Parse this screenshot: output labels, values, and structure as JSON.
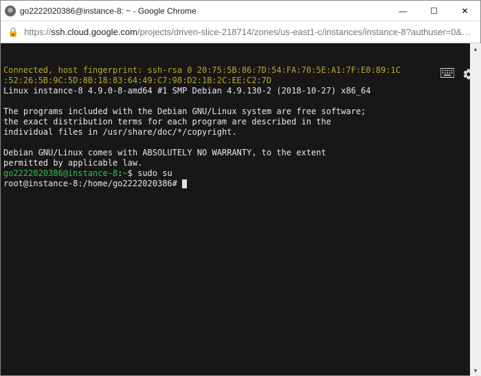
{
  "window": {
    "title": "go2222020386@instance-8: ~ - Google Chrome"
  },
  "address": {
    "scheme": "https://",
    "host": "ssh.cloud.google.com",
    "path": "/projects/driven-slice-218714/zones/us-east1-c/instances/instance-8?authuser=0&hl=zh_CN&..."
  },
  "terminal": {
    "conn_line1": "Connected, host fingerprint: ssh-rsa 0 20:75:5B:86:7D:54:FA:70:5E:A1:7F:E0:89:1C",
    "conn_line2": ":52:26:5B:9C:5D:8B:18:83:64:49:C7:98:D2:1B:2C:EE:C2:7D",
    "kernel": "Linux instance-8 4.9.0-8-amd64 #1 SMP Debian 4.9.130-2 (2018-10-27) x86_64",
    "blank1": "",
    "msg1": "The programs included with the Debian GNU/Linux system are free software;",
    "msg2": "the exact distribution terms for each program are described in the",
    "msg3": "individual files in /usr/share/doc/*/copyright.",
    "blank2": "",
    "msg4": "Debian GNU/Linux comes with ABSOLUTELY NO WARRANTY, to the extent",
    "msg5": "permitted by applicable law.",
    "prompt1_user": "go2222020386@instance-8",
    "prompt1_sep": ":",
    "prompt1_path": "~",
    "prompt1_suffix": "$ ",
    "cmd1": "sudo su",
    "prompt2": "root@instance-8:/home/go2222020386# "
  }
}
